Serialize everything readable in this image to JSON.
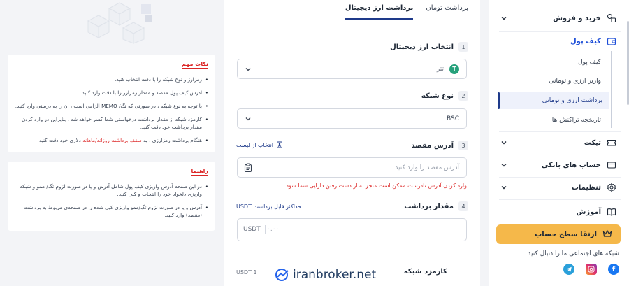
{
  "sidebar": {
    "items": [
      {
        "label": "خرید و فروش",
        "icon": "exchange-icon"
      },
      {
        "label": "کیف پول",
        "icon": "wallet-icon"
      },
      {
        "label": "تیکت",
        "icon": "ticket-icon"
      },
      {
        "label": "حساب های بانکی",
        "icon": "bank-card-icon"
      },
      {
        "label": "تنظیمات",
        "icon": "gear-icon"
      },
      {
        "label": "آموزش",
        "icon": "book-icon"
      }
    ],
    "wallet_sub": [
      {
        "label": "کیف پول"
      },
      {
        "label": "واریز ارزی و تومانی"
      },
      {
        "label": "برداشت ارزی و تومانی"
      },
      {
        "label": "تاریخچه تراکنش ها"
      }
    ],
    "upgrade_label": "ارتقا سطح حساب",
    "social_title": "شبکه های اجتماعی ما را دنبال کنید",
    "socials": [
      "facebook-icon",
      "instagram-icon",
      "telegram-icon"
    ],
    "accent": "#1e3a8a",
    "upgrade_color": "#f5b84a"
  },
  "tabs": [
    {
      "label": "برداشت تومان"
    },
    {
      "label": "برداشت ارز دیجیتال"
    }
  ],
  "form": {
    "step1": {
      "num": "1",
      "label": "انتخاب ارز دیجیتال",
      "value": "تتر"
    },
    "step2": {
      "num": "2",
      "label": "نوع شبکه",
      "value": "BSC"
    },
    "step3": {
      "num": "3",
      "label": "آدرس مقصد",
      "link": "انتخاب از لیست",
      "placeholder": "آدرس مقصد را وارد کنید",
      "warning": "وارد کردن آدرس نادرست ممکن است منجر به از دست رفتن دارایی شما شود."
    },
    "step4": {
      "num": "4",
      "label": "مقدار برداشت",
      "link": "حداکثر قابل برداشت USDT",
      "placeholder": "۰.۰۰",
      "unit": "USDT"
    },
    "fee": {
      "label": "کارمزد شبکه",
      "value": "USDT 1"
    }
  },
  "watermark": "iranbroker.net",
  "notes": {
    "title": "نکات مهم",
    "items": [
      "رمزارز و نوع شبکه را با دقت انتخاب کنید.",
      "آدرس کیف پول مقصد و مقدار رمزارز را با دقت وارد کنید.",
      "با توجه به نوع شبکه ، در صورتی که تگ/ MEMO الزامی است ، آن را به درستی وارد کنید.",
      "کارمزد شبکه از مقدار برداشت درخواستی شما کسر خواهد شد ، بنابراین در وارد کردن مقدار برداشت خود دقت کنید."
    ],
    "last_prefix": "هنگام برداشت رمزارزی ، به",
    "last_red": "سقف برداشت روزانه/ماهانه",
    "last_suffix": "دلاری خود دقت کنید"
  },
  "guide": {
    "title": "راهنما",
    "items": [
      "در این صفحه آدرس واریزی کیف پول شامل آدرس و یا در صورت لزوم تگ/ ممو و شبکه واریزی دلخواه خود را انتخاب و کپی کنید.",
      "آدرس و یا در صورت لزوم تگ/ممو واریزی کپی شده را در صفحه‌ی مربوط به برداشت (مقصد) وارد کنید."
    ]
  }
}
